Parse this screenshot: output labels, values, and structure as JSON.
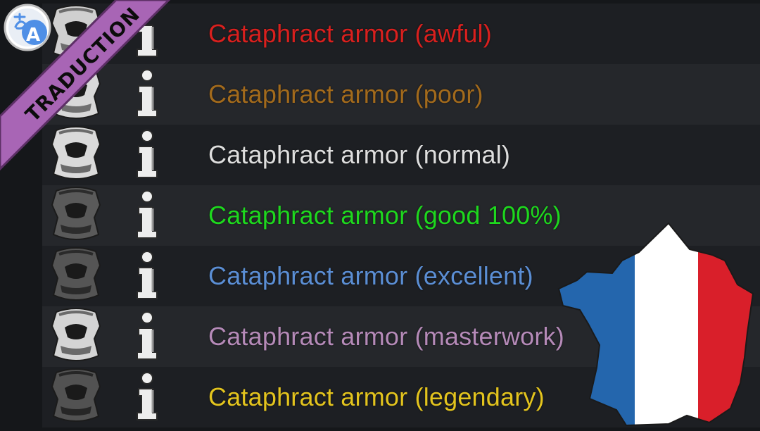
{
  "banner": {
    "text": "TRADUCTION"
  },
  "items": [
    {
      "label": "Cataphract armor (awful)",
      "color": "#d9201e",
      "icon": "armor-icon"
    },
    {
      "label": "Cataphract armor (poor)",
      "color": "#a26a1c",
      "icon": "armor-icon"
    },
    {
      "label": "Cataphract armor (normal)",
      "color": "#dedede",
      "icon": "armor-icon"
    },
    {
      "label": "Cataphract armor (good 100%)",
      "color": "#1ed81e",
      "icon": "armor-icon"
    },
    {
      "label": "Cataphract armor (excellent)",
      "color": "#5b8ed4",
      "icon": "armor-icon"
    },
    {
      "label": "Cataphract armor (masterwork)",
      "color": "#b58ab8",
      "icon": "armor-icon"
    },
    {
      "label": "Cataphract armor (legendary)",
      "color": "#e3c41e",
      "icon": "armor-icon"
    }
  ],
  "colors": {
    "banner": "#a865b5",
    "flag_blue": "#2466ad",
    "flag_white": "#ffffff",
    "flag_red": "#d91f2a",
    "translate_badge_blue": "#4f8fe6"
  }
}
